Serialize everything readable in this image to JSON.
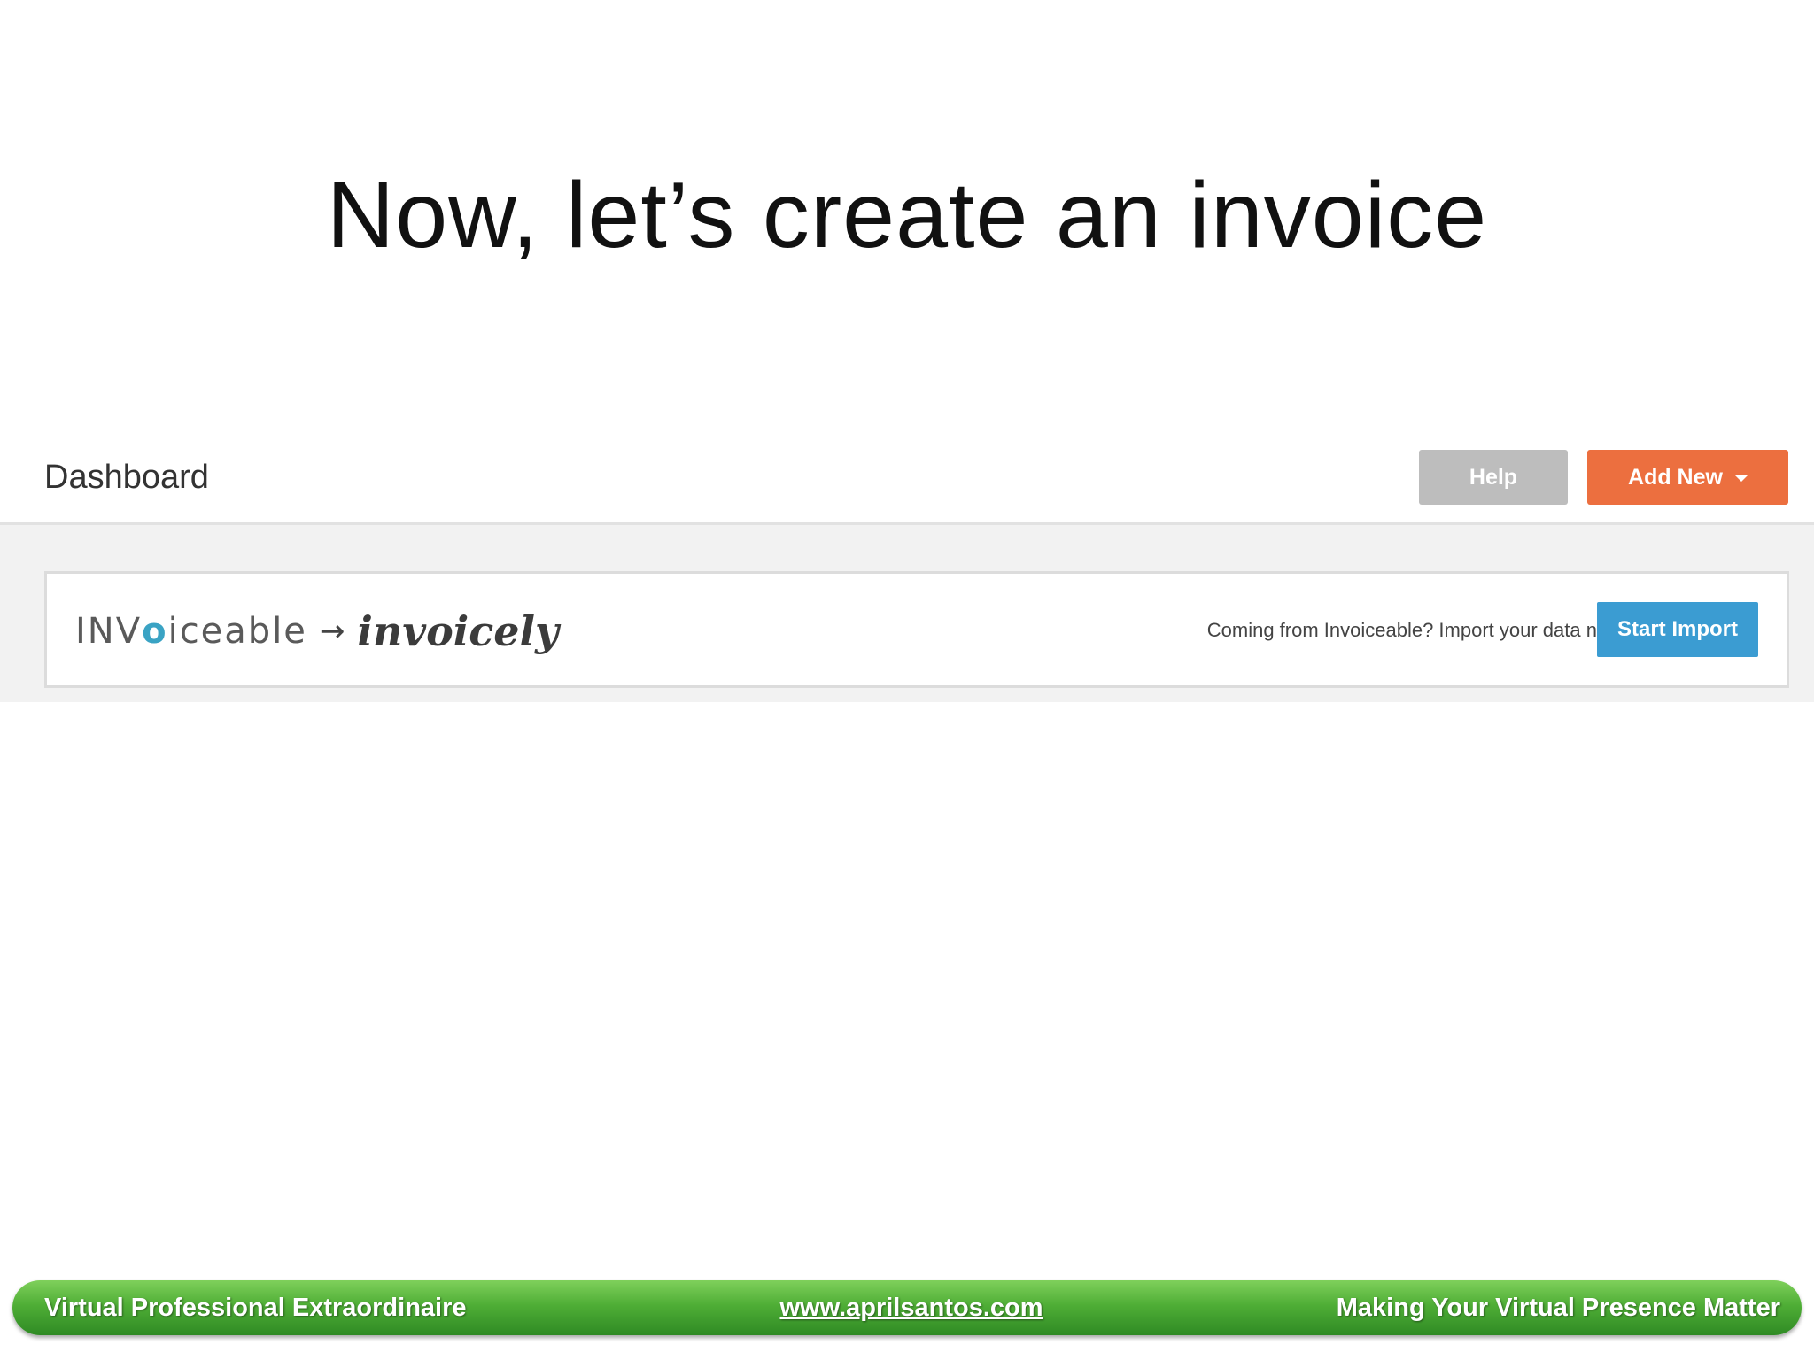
{
  "slide": {
    "title": "Now, let’s create an invoice"
  },
  "app": {
    "header": {
      "title": "Dashboard",
      "help_label": "Help",
      "add_new_label": "Add New"
    },
    "banner": {
      "logo_old_prefix": "INV",
      "logo_old_ring": "o",
      "logo_old_suffix": "iceable",
      "logo_arrow": "→",
      "logo_new": "invoicely",
      "message": "Coming from Invoiceable? Import your data now.",
      "start_import_label": "Start Import"
    },
    "colors": {
      "help_button": "#bdbdbd",
      "add_new_button": "#ec6f3f",
      "start_import_button": "#3b9cd2"
    }
  },
  "footer": {
    "left": "Virtual Professional Extraordinaire",
    "center": "www.aprilsantos.com",
    "right": "Making Your Virtual Presence Matter",
    "color": "#4fae36"
  }
}
